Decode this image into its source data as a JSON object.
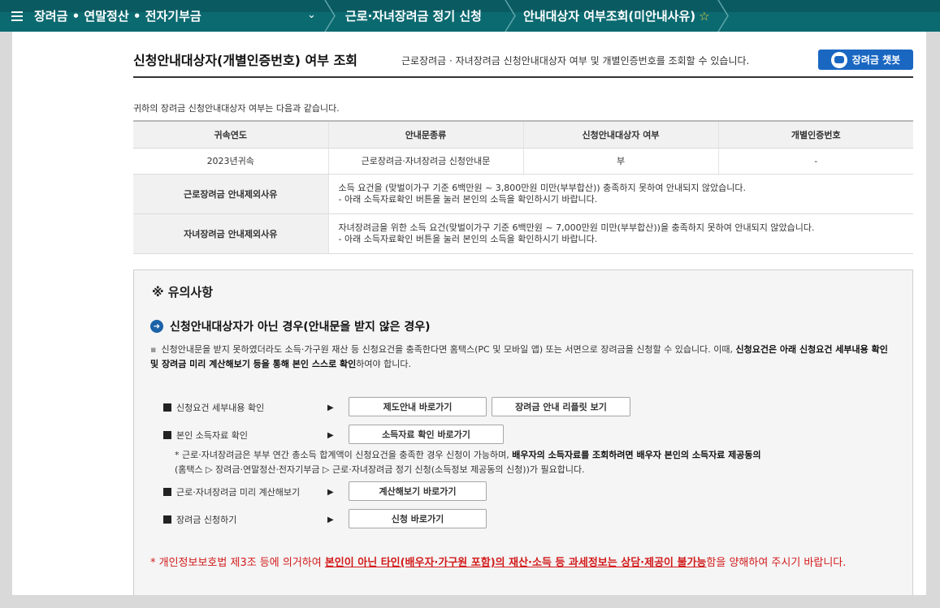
{
  "nav": {
    "crumb1": "장려금 • 연말정산 • 전자기부금",
    "crumb2": "근로·자녀장려금 정기 신청",
    "crumb3": "안내대상자 여부조회(미안내사유)"
  },
  "header": {
    "title": "신청안내대상자(개별인증번호) 여부 조회",
    "description": "근로장려금 · 자녀장려금 신청안내대상자 여부 및 개별인증번호를 조회할 수 있습니다.",
    "chatbot_label": "장려금 챗봇"
  },
  "result": {
    "intro": "귀하의 장려금 신청안내대상자 여부는 다음과 같습니다.",
    "columns": [
      "귀속연도",
      "안내문종류",
      "신청안내대상자 여부",
      "개별인증번호"
    ],
    "row": [
      "2023년귀속",
      "근로장려금·자녀장려금 신청안내문",
      "부",
      "-"
    ],
    "reasons": [
      {
        "label": "근로장려금 안내제외사유",
        "line1": "소득 요건을 (맞벌이가구 기준 6백만원 ~ 3,800만원 미만(부부합산)) 충족하지 못하여 안내되지 않았습니다.",
        "line2": "- 아래 소득자료확인 버튼을 눌러 본인의 소득을 확인하시기 바랍니다."
      },
      {
        "label": "자녀장려금 안내제외사유",
        "line1": "자녀장려금을 위한 소득 요건(맞벌이가구 기준 6백만원 ~ 7,000만원 미만(부부합산))을 충족하지 못하여 안내되지 않았습니다.",
        "line2": "- 아래 소득자료확인 버튼을 눌러 본인의 소득을 확인하시기 바랍니다."
      }
    ]
  },
  "notice": {
    "title": "※ 유의사항",
    "subtitle": "신청안내대상자가 아닌 경우(안내문을 받지 않은 경우)",
    "body_plain": "신청안내문을 받지 못하였더라도 소득·가구원 재산 등 신청요건을 충족한다면 홈택스(PC 및 모바일 앱) 또는 서면으로 장려금을 신청할 수 있습니다. 이때, ",
    "body_bold": "신청요건은 아래 신청요건 세부내용 확인 및 장려금 미리 계산해보기 등을 통해 본인 스스로 확인",
    "body_tail": "하여야 합니다.",
    "rows": [
      {
        "label": "신청요건 세부내용 확인",
        "button1": "제도안내 바로가기",
        "button2": "장려금 안내 리플릿 보기"
      },
      {
        "label": "본인 소득자료 확인",
        "button1": "소득자료 확인 바로가기"
      },
      {
        "label": "근로·자녀장려금 미리 계산해보기",
        "button1": "계산해보기 바로가기"
      },
      {
        "label": "장려금 신청하기",
        "button1": "신청 바로가기"
      }
    ],
    "note_plain1": "* 근로·자녀장려금은 부부 연간 총소득 합계액이 신청요건을 충족한 경우 신청이 가능하며, ",
    "note_bold": "배우자의 소득자료를 조회하려면 배우자 본인의 소득자료 제공동의",
    "note_plain2": "(홈택스 ▷ 장려금·연말정산·전자기부금 ▷ 근로·자녀장려금 정기 신청(소득정보 제공동의 신청))가 필요합니다.",
    "warn_plain1": "* 개인정보보호법 제3조 등에 의거하여 ",
    "warn_bold": "본인이 아닌 타인(배우자·가구원 포함)의 재산·소득 등 과세정보는 상담·제공이 불가능",
    "warn_plain2": "함을 양해하여 주시기 바랍니다."
  },
  "colors": {
    "nav_bg": "#0b6a70",
    "chatbot_bg": "#1a67c2",
    "warning_red": "#d21a1a"
  }
}
